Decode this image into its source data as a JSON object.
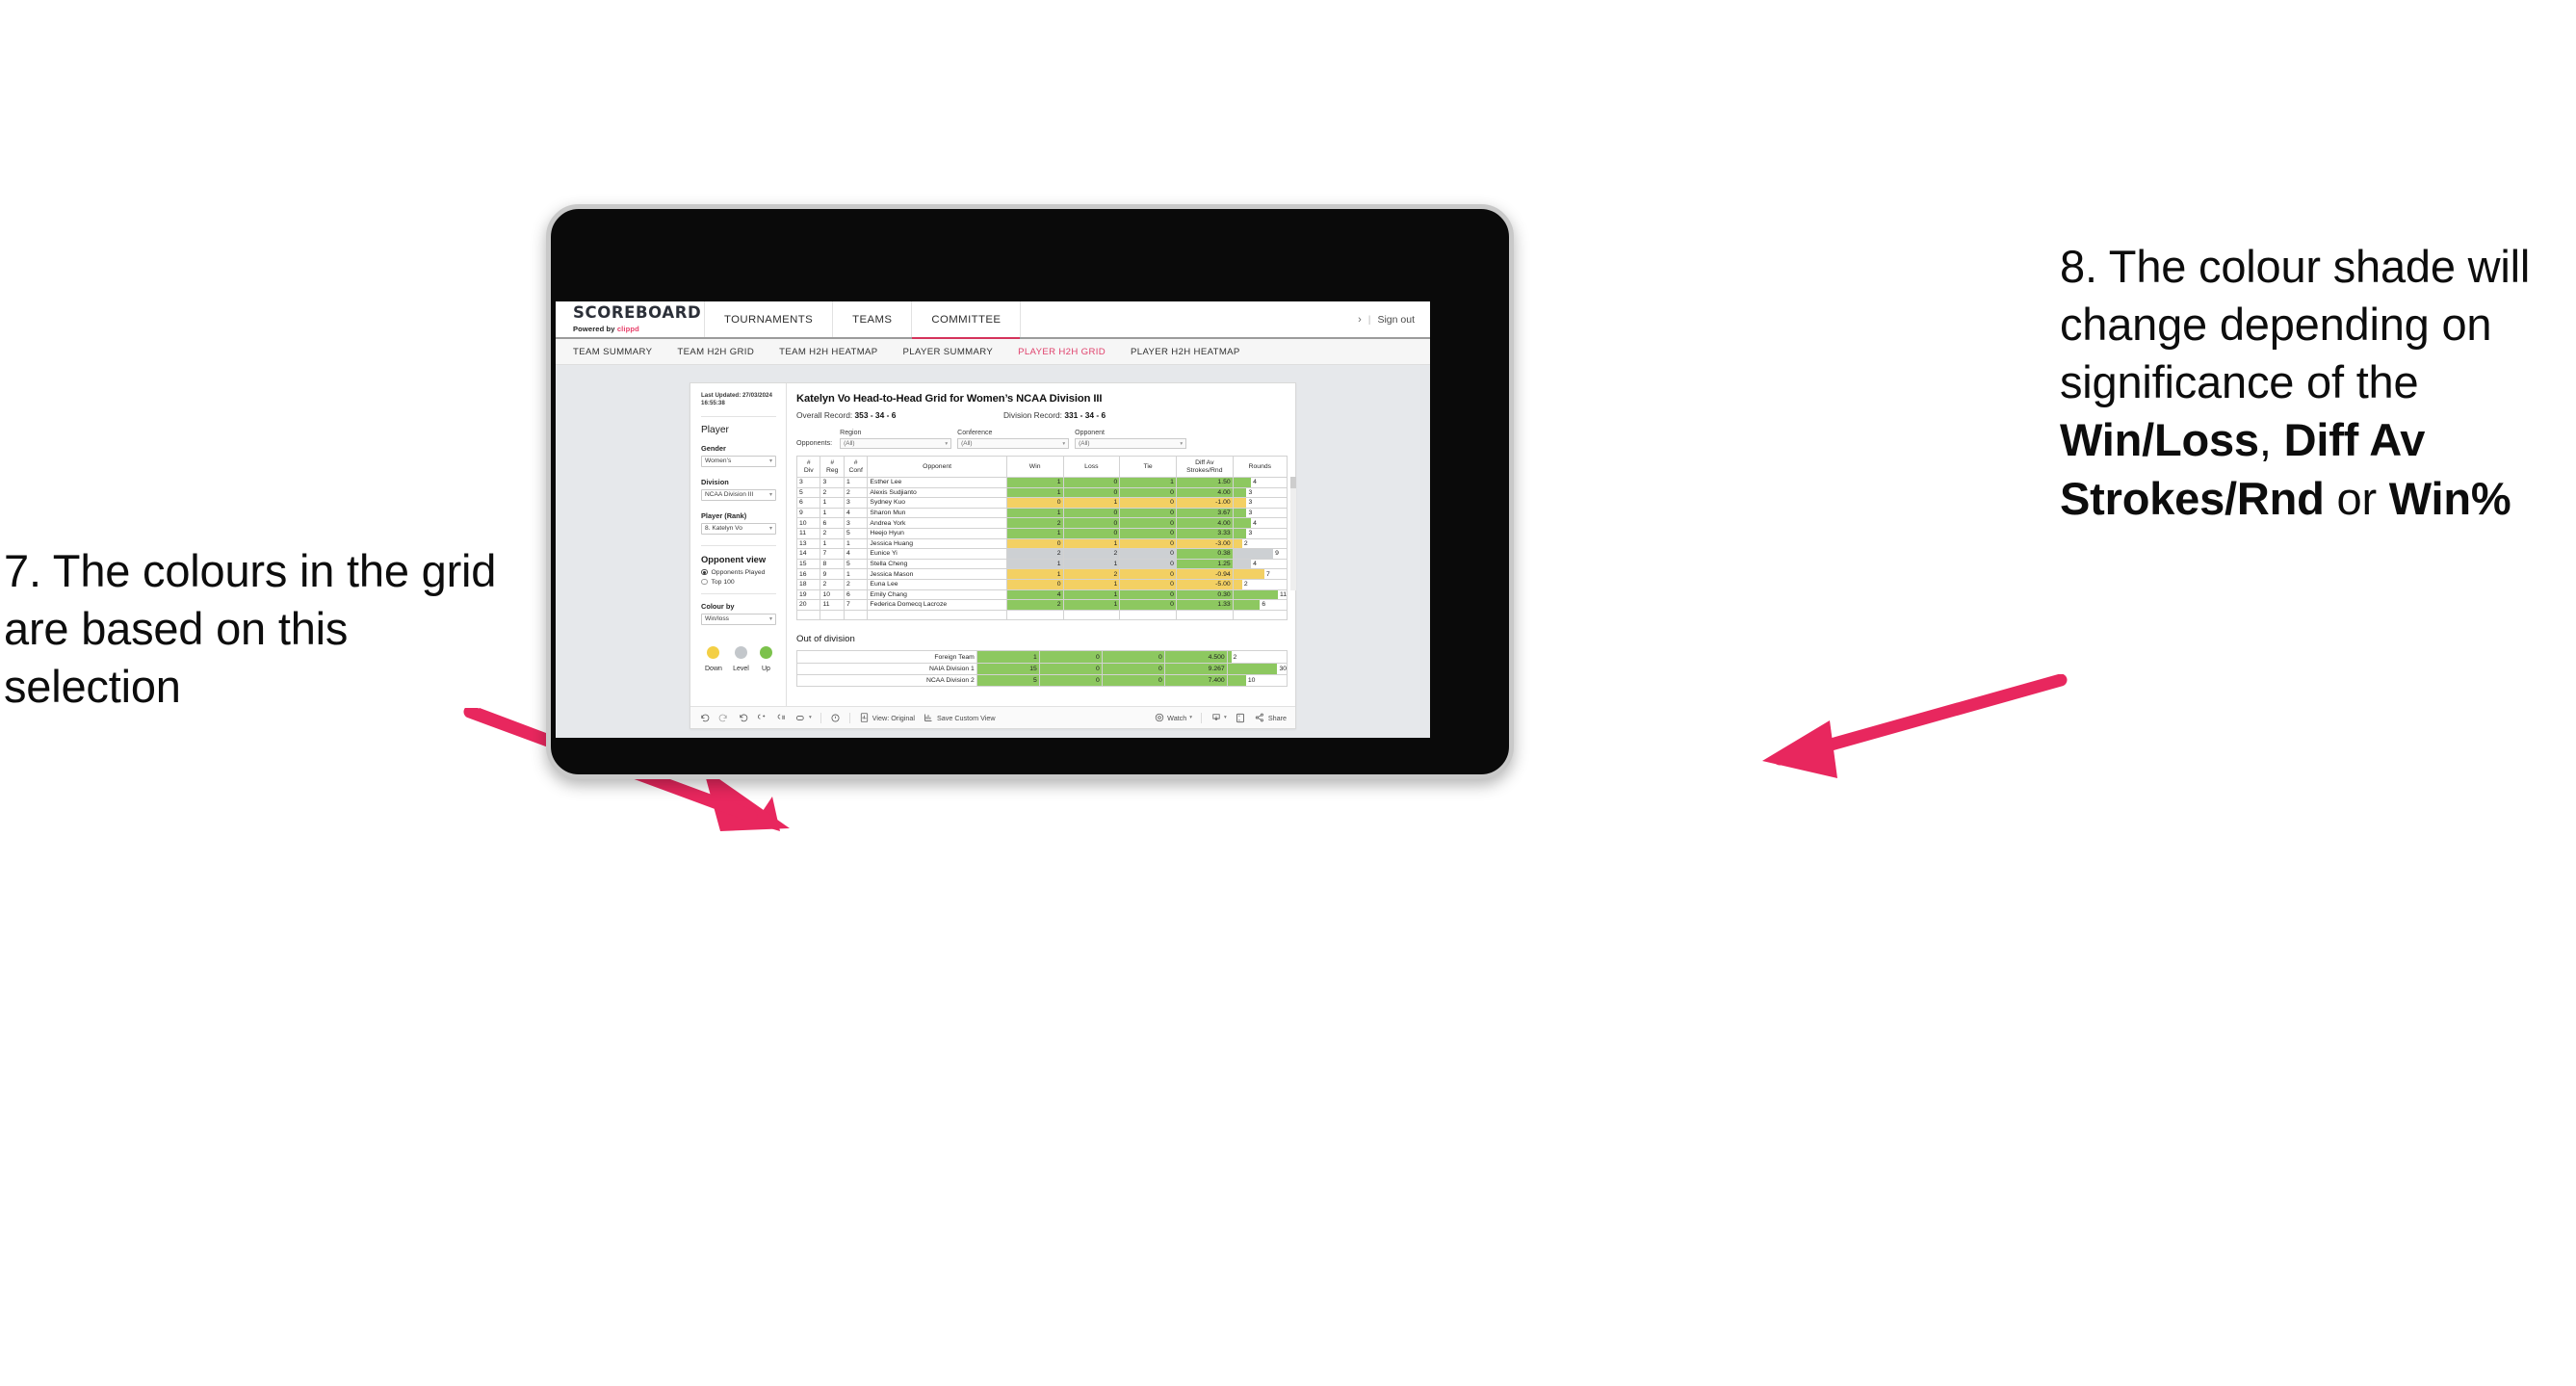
{
  "annotations": {
    "left": {
      "name": "callout-7",
      "text": "7. The colours in the grid are based on this selection"
    },
    "right": {
      "name": "callout-8",
      "part1": "8. The colour shade will change depending on significance of the ",
      "bold1": "Win/Loss",
      "mid1": ", ",
      "bold2": "Diff Av Strokes/Rnd",
      "mid2": " or ",
      "bold3": "Win%"
    },
    "arrow_color": "#e8275e"
  },
  "app": {
    "brand": {
      "title": "SCOREBOARD",
      "sub_prefix": "Powered by ",
      "sub_brand": "clippd"
    },
    "nav": [
      {
        "label": "TOURNAMENTS",
        "active": false
      },
      {
        "label": "TEAMS",
        "active": false
      },
      {
        "label": "COMMITTEE",
        "active": true
      }
    ],
    "account": {
      "chevron": "›",
      "separator": "|",
      "sign_out": "Sign out"
    },
    "subnav": [
      {
        "label": "TEAM SUMMARY",
        "active": false
      },
      {
        "label": "TEAM H2H GRID",
        "active": false
      },
      {
        "label": "TEAM H2H HEATMAP",
        "active": false
      },
      {
        "label": "PLAYER SUMMARY",
        "active": false
      },
      {
        "label": "PLAYER H2H GRID",
        "active": true
      },
      {
        "label": "PLAYER H2H HEATMAP",
        "active": false
      }
    ],
    "accent": "#d5335b"
  },
  "sidebar": {
    "last_updated_line1": "Last Updated: 27/03/2024",
    "last_updated_line2": "16:55:38",
    "player_heading": "Player",
    "fields": [
      {
        "label": "Gender",
        "value": "Women’s"
      },
      {
        "label": "Division",
        "value": "NCAA Division III"
      },
      {
        "label": "Player (Rank)",
        "value": "8. Katelyn Vo"
      }
    ],
    "opponent_view": {
      "heading": "Opponent view",
      "options": [
        {
          "label": "Opponents Played",
          "selected": true
        },
        {
          "label": "Top 100",
          "selected": false
        }
      ]
    },
    "colour_by": {
      "label": "Colour by",
      "value": "Win/loss"
    },
    "legend": [
      {
        "label": "Down",
        "color": "#f3cf45"
      },
      {
        "label": "Level",
        "color": "#c3c7cb"
      },
      {
        "label": "Up",
        "color": "#7cc24c"
      }
    ]
  },
  "main": {
    "title": "Katelyn Vo Head-to-Head Grid for Women’s NCAA Division III",
    "overall_record_label": "Overall Record:",
    "overall_record_value": "353 -  34 - 6",
    "division_record_label": "Division Record:",
    "division_record_value": "331 -  34 - 6",
    "opponents_label": "Opponents:",
    "filters": [
      {
        "label": "Region",
        "value": "(All)"
      },
      {
        "label": "Conference",
        "value": "(All)"
      },
      {
        "label": "Opponent",
        "value": "(All)"
      }
    ]
  },
  "chart_data": {
    "type": "table",
    "title": "Katelyn Vo Head-to-Head Grid for Women’s NCAA Division III",
    "columns": [
      "# Div",
      "# Reg",
      "# Conf",
      "Opponent",
      "Win",
      "Loss",
      "Tie",
      "Diff Av Strokes/Rnd",
      "Rounds"
    ],
    "header_lines": [
      [
        "#",
        "Div"
      ],
      [
        "#",
        "Reg"
      ],
      [
        "#",
        "Conf"
      ],
      [
        "Opponent"
      ],
      [
        "Win"
      ],
      [
        "Loss"
      ],
      [
        "Tie"
      ],
      [
        "Diff Av",
        "Strokes/Rnd"
      ],
      [
        "Rounds"
      ]
    ],
    "rounds_max": 12,
    "rows": [
      {
        "div": "3",
        "reg": "3",
        "conf": "1",
        "opponent": "Esther Lee",
        "win": "1",
        "loss": "0",
        "tie": "1",
        "diff": "1.50",
        "rounds": "4",
        "shade": "up"
      },
      {
        "div": "5",
        "reg": "2",
        "conf": "2",
        "opponent": "Alexis Sudjianto",
        "win": "1",
        "loss": "0",
        "tie": "0",
        "diff": "4.00",
        "rounds": "3",
        "shade": "up"
      },
      {
        "div": "6",
        "reg": "1",
        "conf": "3",
        "opponent": "Sydney Kuo",
        "win": "0",
        "loss": "1",
        "tie": "0",
        "diff": "-1.00",
        "rounds": "3",
        "shade": "down"
      },
      {
        "div": "9",
        "reg": "1",
        "conf": "4",
        "opponent": "Sharon Mun",
        "win": "1",
        "loss": "0",
        "tie": "0",
        "diff": "3.67",
        "rounds": "3",
        "shade": "up"
      },
      {
        "div": "10",
        "reg": "6",
        "conf": "3",
        "opponent": "Andrea York",
        "win": "2",
        "loss": "0",
        "tie": "0",
        "diff": "4.00",
        "rounds": "4",
        "shade": "up"
      },
      {
        "div": "11",
        "reg": "2",
        "conf": "5",
        "opponent": "Heejo Hyun",
        "win": "1",
        "loss": "0",
        "tie": "0",
        "diff": "3.33",
        "rounds": "3",
        "shade": "up"
      },
      {
        "div": "13",
        "reg": "1",
        "conf": "1",
        "opponent": "Jessica Huang",
        "win": "0",
        "loss": "1",
        "tie": "0",
        "diff": "-3.00",
        "rounds": "2",
        "shade": "down"
      },
      {
        "div": "14",
        "reg": "7",
        "conf": "4",
        "opponent": "Eunice Yi",
        "win": "2",
        "loss": "2",
        "tie": "0",
        "diff": "0.38",
        "rounds": "9",
        "shade": "level",
        "diff_shade": "up"
      },
      {
        "div": "15",
        "reg": "8",
        "conf": "5",
        "opponent": "Stella Cheng",
        "win": "1",
        "loss": "1",
        "tie": "0",
        "diff": "1.25",
        "rounds": "4",
        "shade": "level",
        "diff_shade": "up"
      },
      {
        "div": "16",
        "reg": "9",
        "conf": "1",
        "opponent": "Jessica Mason",
        "win": "1",
        "loss": "2",
        "tie": "0",
        "diff": "-0.94",
        "rounds": "7",
        "shade": "down"
      },
      {
        "div": "18",
        "reg": "2",
        "conf": "2",
        "opponent": "Euna Lee",
        "win": "0",
        "loss": "1",
        "tie": "0",
        "diff": "-5.00",
        "rounds": "2",
        "shade": "down"
      },
      {
        "div": "19",
        "reg": "10",
        "conf": "6",
        "opponent": "Emily Chang",
        "win": "4",
        "loss": "1",
        "tie": "0",
        "diff": "0.30",
        "rounds": "11",
        "shade": "up"
      },
      {
        "div": "20",
        "reg": "11",
        "conf": "7",
        "opponent": "Federica Domecq Lacroze",
        "win": "2",
        "loss": "1",
        "tie": "0",
        "diff": "1.33",
        "rounds": "6",
        "shade": "up"
      }
    ],
    "out_of_division": {
      "title": "Out of division",
      "rounds_max": 32,
      "rows": [
        {
          "name": "Foreign Team",
          "win": "1",
          "loss": "0",
          "tie": "0",
          "diff": "4.500",
          "rounds": "2",
          "shade": "up"
        },
        {
          "name": "NAIA Division 1",
          "win": "15",
          "loss": "0",
          "tie": "0",
          "diff": "9.267",
          "rounds": "30",
          "shade": "up"
        },
        {
          "name": "NCAA Division 2",
          "win": "5",
          "loss": "0",
          "tie": "0",
          "diff": "7.400",
          "rounds": "10",
          "shade": "up"
        }
      ]
    },
    "shade_colors": {
      "up": "#8dc860",
      "down": "#f3d063",
      "level": "#cdd0d3",
      "none": "#ffffff"
    }
  },
  "toolbar": {
    "undo_icon": "undo-icon",
    "redo_icon": "redo-icon",
    "revert_icon": "revert-icon",
    "refresh_icon": "refresh-data-icon",
    "pause_icon": "pause-updates-icon",
    "highlight_icon": "highlight-icon",
    "alert_icon": "alerts-icon",
    "view_label": "View: Original",
    "save_label": "Save Custom View",
    "watch_label": "Watch",
    "download_icon": "download-icon",
    "fullscreen_icon": "fullscreen-icon",
    "share_label": "Share"
  }
}
